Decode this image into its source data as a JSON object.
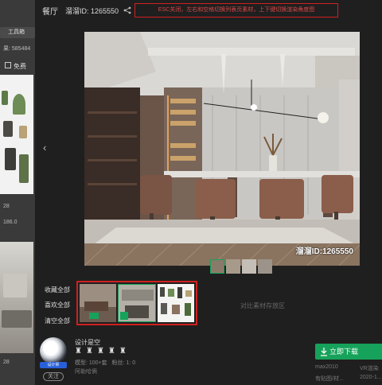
{
  "background_page": {
    "tab_label": "工具箱",
    "stat_text": "果: 585484",
    "checkbox_label": "免费",
    "count_a": "28",
    "count_b": "186.0",
    "count_c": "28"
  },
  "header": {
    "title": "餐厅",
    "render_id": "溜溜ID: 1265550",
    "hint": "ESC关闭，左右和空格切换列表页素材，上下键切换渲染角度图"
  },
  "main_image": {
    "watermark": "溜溜ID:1265550"
  },
  "compare": {
    "collect_all": "收藏全部",
    "like_all": "喜欢全部",
    "clear_all": "清空全部",
    "area_label": "对比素材存放区"
  },
  "designer": {
    "name": "设计是空",
    "avatar_badge": "设计师",
    "follow_label": "关注",
    "models": "模型: 100+套",
    "fans": "粉丝: 1: 0",
    "location": "阿勒哈俩"
  },
  "download": {
    "label": "立即下载",
    "version": "max2010",
    "renderer": "VR渲染",
    "style": "有贴图/材...",
    "date": "2020-1..."
  },
  "colors": {
    "accent_red": "#d02020",
    "download_green": "#16a25a",
    "modal_bg": "#1f1f1f"
  }
}
